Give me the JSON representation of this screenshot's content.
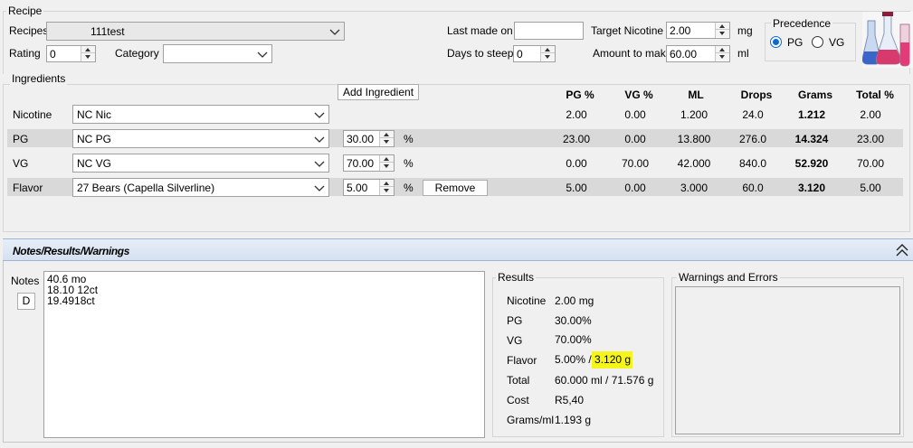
{
  "recipe_group": {
    "title": "Recipe",
    "recipes_label": "Recipes",
    "recipe_value": "111test",
    "rating_label": "Rating",
    "rating_value": "0",
    "category_label": "Category",
    "category_value": "",
    "last_made_label": "Last made on",
    "last_made_value": "",
    "days_to_steep_label": "Days to steep",
    "days_to_steep_value": "0",
    "target_nicotine_label": "Target Nicotine",
    "target_nicotine_value": "2.00",
    "target_nicotine_unit": "mg",
    "amount_label": "Amount to make",
    "amount_value": "60.00",
    "amount_unit": "ml"
  },
  "precedence": {
    "title": "Precedence",
    "options": [
      "PG",
      "VG"
    ],
    "selected": "PG"
  },
  "ingredients": {
    "title": "Ingredients",
    "add_button": "Add Ingredient",
    "columns": [
      "PG %",
      "VG %",
      "ML",
      "Drops",
      "Grams",
      "Total %"
    ],
    "percent_symbol": "%",
    "remove_button": "Remove",
    "rows": [
      {
        "label": "Nicotine",
        "item": "NC Nic",
        "percent": "",
        "pg": "2.00",
        "vg": "0.00",
        "ml": "1.200",
        "drops": "24.0",
        "grams": "1.212",
        "total": "2.00"
      },
      {
        "label": "PG",
        "item": "NC PG",
        "percent": "30.00",
        "pg": "23.00",
        "vg": "0.00",
        "ml": "13.800",
        "drops": "276.0",
        "grams": "14.324",
        "total": "23.00"
      },
      {
        "label": "VG",
        "item": "NC VG",
        "percent": "70.00",
        "pg": "0.00",
        "vg": "70.00",
        "ml": "42.000",
        "drops": "840.0",
        "grams": "52.920",
        "total": "70.00"
      },
      {
        "label": "Flavor",
        "item": "27 Bears (Capella Silverline)",
        "percent": "5.00",
        "pg": "5.00",
        "vg": "0.00",
        "ml": "3.000",
        "drops": "60.0",
        "grams": "3.120",
        "total": "5.00"
      }
    ]
  },
  "notes_panel": {
    "title": "Notes/Results/Warnings",
    "notes_label": "Notes",
    "d_button": "D",
    "notes_lines": [
      "40.6 mo",
      "18.10 12ct",
      "19.4918ct"
    ]
  },
  "results": {
    "title": "Results",
    "items": [
      {
        "label": "Nicotine",
        "value": "2.00 mg"
      },
      {
        "label": "PG",
        "value": "30.00%"
      },
      {
        "label": "VG",
        "value": "70.00%"
      },
      {
        "label": "Flavor",
        "value": "5.00% /",
        "value_highlight": " 3.120 g"
      },
      {
        "label": "Total",
        "value": "60.000 ml / 71.576 g"
      },
      {
        "label": "Cost",
        "value": "R5,40"
      },
      {
        "label": "Grams/ml",
        "value": "1.193 g"
      }
    ],
    "highlight_color": "#f5f51d"
  },
  "warnings": {
    "title": "Warnings and Errors"
  },
  "colors": {
    "window_bg": "#f0f0f0",
    "row_shade": "#d9d9d9",
    "panel_header": "#dde8f5",
    "radio_accent": "#0a6ad1"
  },
  "icons": [
    "chevron-down-icon",
    "spin-up-icon",
    "spin-down-icon",
    "collapse-chevrons-icon",
    "lab-flasks-icon"
  ]
}
